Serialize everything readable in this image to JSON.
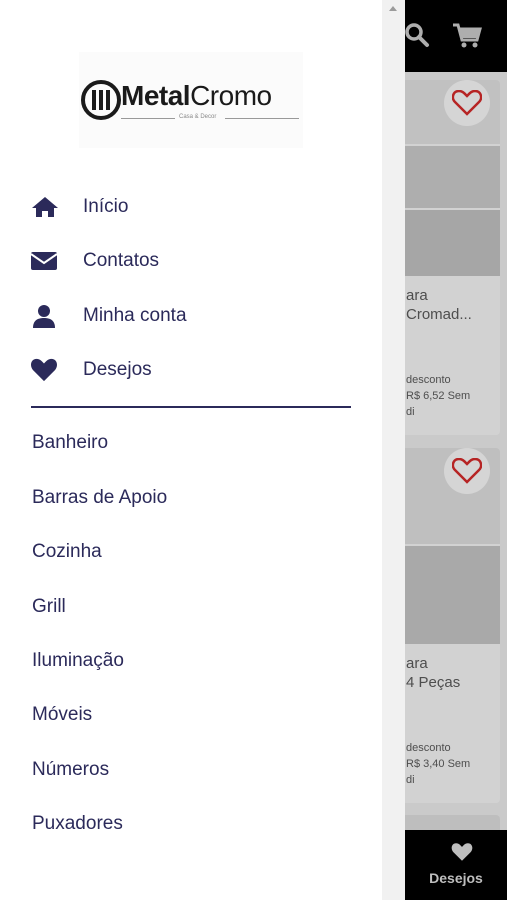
{
  "brand": {
    "name_bold": "Metal",
    "name_light": "Cromo",
    "tagline": "Casa & Decor"
  },
  "nav": [
    {
      "label": "Início",
      "icon": "home-icon"
    },
    {
      "label": "Contatos",
      "icon": "envelope-icon"
    },
    {
      "label": "Minha conta",
      "icon": "user-icon"
    },
    {
      "label": "Desejos",
      "icon": "heart-icon"
    }
  ],
  "categories": [
    "Banheiro",
    "Barras de Apoio",
    "Cozinha",
    "Grill",
    "Iluminação",
    "Móveis",
    "Números",
    "Puxadores"
  ],
  "background": {
    "products": [
      {
        "title_line1": "ara",
        "title_line2": "Cromad...",
        "discount": "desconto",
        "price": "R$ 6,52 Sem",
        "extra": "di"
      },
      {
        "title_line1": "ara",
        "title_line2": "4 Peças",
        "discount": "desconto",
        "price": "R$ 3,40 Sem",
        "extra": "di"
      }
    ],
    "bottom_nav_label": "Desejos"
  },
  "colors": {
    "menu_text": "#2b2a5a",
    "header_bg": "#000000",
    "fav_heart": "#c62828"
  }
}
